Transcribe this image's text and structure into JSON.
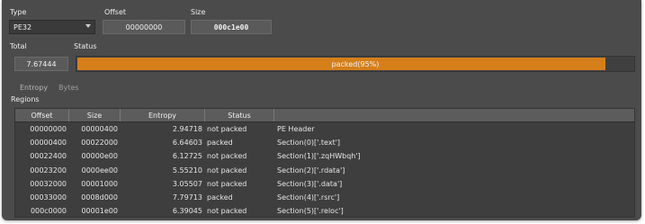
{
  "type": {
    "label": "Type",
    "value": "PE32"
  },
  "offset": {
    "label": "Offset",
    "value": "00000000"
  },
  "size": {
    "label": "Size",
    "value": "000c1e00"
  },
  "total": {
    "label": "Total",
    "value": "7.67444"
  },
  "status": {
    "label": "Status",
    "text": "packed(95%)",
    "fraction": 0.95,
    "color": "#d57f1b"
  },
  "tabs": [
    {
      "label": "Entropy"
    },
    {
      "label": "Bytes"
    }
  ],
  "regions": {
    "label": "Regions",
    "columns": [
      "Offset",
      "Size",
      "Entropy",
      "Status",
      ""
    ],
    "rows": [
      {
        "offset": "00000000",
        "size": "00000400",
        "entropy": "2.94718",
        "status": "not packed",
        "name": "PE Header"
      },
      {
        "offset": "00000400",
        "size": "00022000",
        "entropy": "6.64603",
        "status": "packed",
        "name": "Section(0)['.text']"
      },
      {
        "offset": "00022400",
        "size": "00000e00",
        "entropy": "6.12725",
        "status": "not packed",
        "name": "Section(1)['.zqHWbqh']"
      },
      {
        "offset": "00023200",
        "size": "0000ee00",
        "entropy": "5.55210",
        "status": "not packed",
        "name": "Section(2)['.rdata']"
      },
      {
        "offset": "00032000",
        "size": "00001000",
        "entropy": "3.05507",
        "status": "not packed",
        "name": "Section(3)['.data']"
      },
      {
        "offset": "00033000",
        "size": "0008d000",
        "entropy": "7.79713",
        "status": "packed",
        "name": "Section(4)['.rsrc']"
      },
      {
        "offset": "000c0000",
        "size": "00001e00",
        "entropy": "6.39045",
        "status": "not packed",
        "name": "Section(5)['.reloc']"
      }
    ]
  }
}
